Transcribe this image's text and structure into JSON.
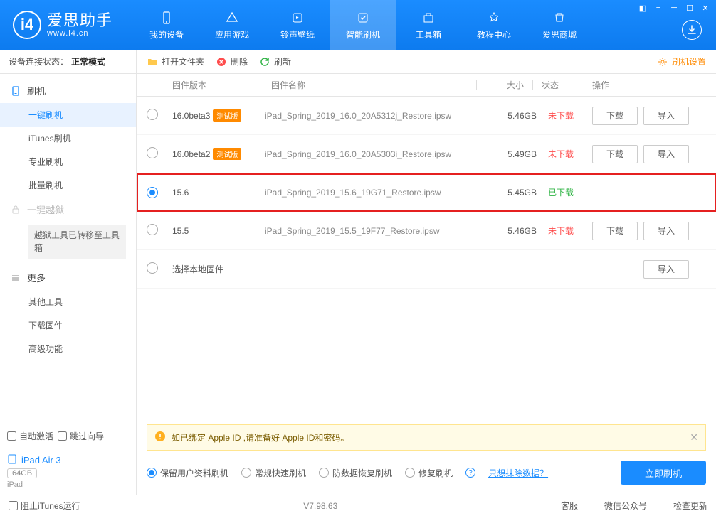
{
  "header": {
    "logo_main": "爱思助手",
    "logo_sub": "www.i4.cn",
    "nav": [
      "我的设备",
      "应用游戏",
      "铃声壁纸",
      "智能刷机",
      "工具箱",
      "教程中心",
      "爱思商城"
    ],
    "active_nav": 3
  },
  "sidebar": {
    "status_label": "设备连接状态：",
    "status_value": "正常模式",
    "flash_head": "刷机",
    "flash_items": [
      "一键刷机",
      "iTunes刷机",
      "专业刷机",
      "批量刷机"
    ],
    "flash_active": 0,
    "jailbreak_head": "一键越狱",
    "jailbreak_note": "越狱工具已转移至工具箱",
    "more_head": "更多",
    "more_items": [
      "其他工具",
      "下载固件",
      "高级功能"
    ],
    "auto_activate": "自动激活",
    "skip_guide": "跳过向导",
    "device_name": "iPad Air 3",
    "device_cap": "64GB",
    "device_type": "iPad"
  },
  "toolbar": {
    "open_folder": "打开文件夹",
    "delete": "删除",
    "refresh": "刷新",
    "settings": "刷机设置"
  },
  "table": {
    "headers": {
      "version": "固件版本",
      "name": "固件名称",
      "size": "大小",
      "status": "状态",
      "ops": "操作"
    },
    "beta_tag": "测试版",
    "download_btn": "下载",
    "import_btn": "导入",
    "status_no": "未下载",
    "status_yes": "已下载",
    "local_firmware": "选择本地固件",
    "rows": [
      {
        "version": "16.0beta3",
        "beta": true,
        "name": "iPad_Spring_2019_16.0_20A5312j_Restore.ipsw",
        "size": "5.46GB",
        "downloaded": false,
        "selected": false
      },
      {
        "version": "16.0beta2",
        "beta": true,
        "name": "iPad_Spring_2019_16.0_20A5303i_Restore.ipsw",
        "size": "5.49GB",
        "downloaded": false,
        "selected": false
      },
      {
        "version": "15.6",
        "beta": false,
        "name": "iPad_Spring_2019_15.6_19G71_Restore.ipsw",
        "size": "5.45GB",
        "downloaded": true,
        "selected": true
      },
      {
        "version": "15.5",
        "beta": false,
        "name": "iPad_Spring_2019_15.5_19F77_Restore.ipsw",
        "size": "5.46GB",
        "downloaded": false,
        "selected": false
      }
    ]
  },
  "warning": "如已绑定 Apple ID ,请准备好 Apple ID和密码。",
  "options": {
    "items": [
      "保留用户资料刷机",
      "常规快速刷机",
      "防数据恢复刷机",
      "修复刷机"
    ],
    "selected": 0,
    "erase_link": "只想抹除数据？",
    "flash_btn": "立即刷机"
  },
  "footer": {
    "block_itunes": "阻止iTunes运行",
    "version": "V7.98.63",
    "links": [
      "客服",
      "微信公众号",
      "检查更新"
    ]
  }
}
